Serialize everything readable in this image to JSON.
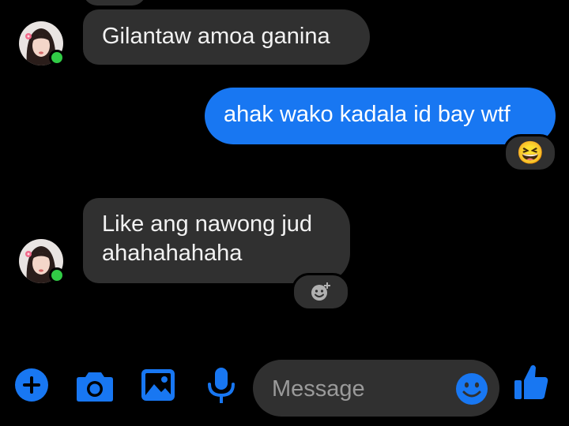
{
  "conversation": {
    "messages": [
      {
        "direction": "received",
        "text": "Gilantaw amoa ganina"
      },
      {
        "direction": "sent",
        "text": "ahak wako kadala id bay wtf",
        "reaction": "😆"
      },
      {
        "direction": "received",
        "lines": [
          "Like ang nawong jud",
          "ahahahahaha"
        ],
        "reaction_icon": "add-reaction-icon"
      }
    ]
  },
  "composer": {
    "tools": [
      "plus-icon",
      "camera-icon",
      "gallery-icon",
      "microphone-icon"
    ],
    "message_placeholder": "Message",
    "emoji_icon": "smiley-icon",
    "like_icon": "thumbs-up-icon"
  },
  "colors": {
    "background": "#000000",
    "received_bubble": "#303030",
    "sent_bubble": "#1877f2",
    "accent": "#1877f2",
    "online": "#31cc46"
  }
}
